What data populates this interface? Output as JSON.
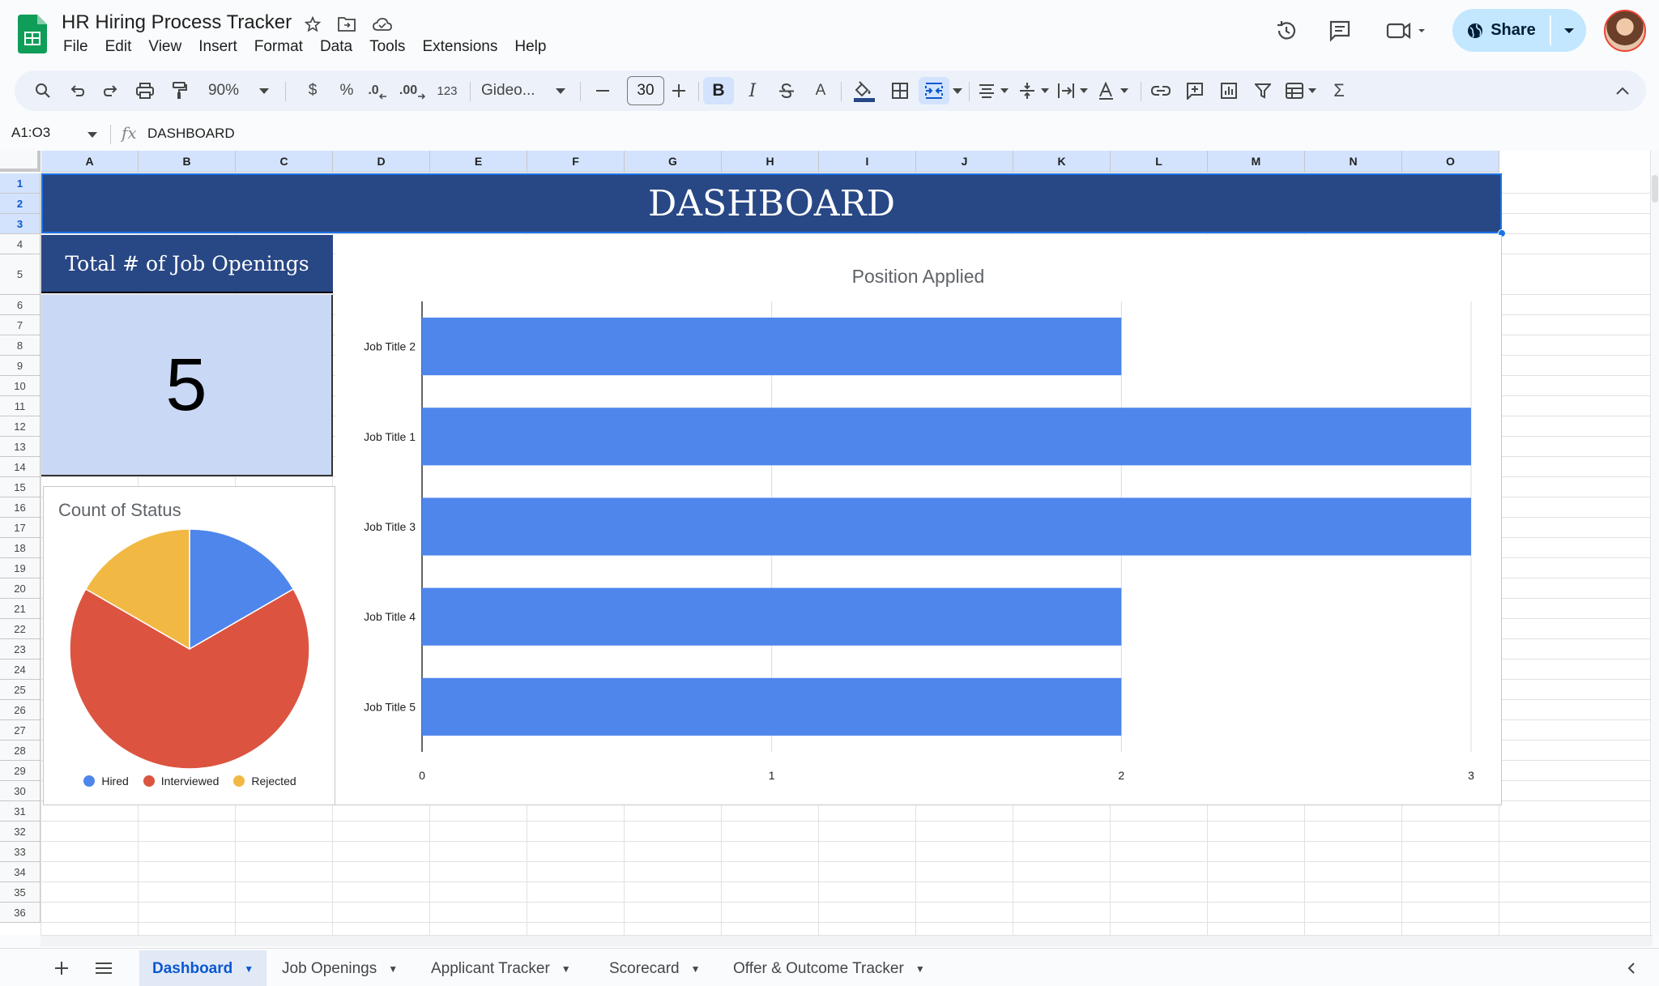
{
  "document": {
    "title": "HR Hiring Process Tracker",
    "menu": [
      "File",
      "Edit",
      "View",
      "Insert",
      "Format",
      "Data",
      "Tools",
      "Extensions",
      "Help"
    ]
  },
  "header": {
    "share_label": "Share"
  },
  "toolbar": {
    "zoom": "90%",
    "currency": "$",
    "percent": "%",
    "decrease_decimal": ".0",
    "increase_decimal": ".00",
    "number_format": "123",
    "font": "Gideo...",
    "font_size": "30",
    "bold": "B",
    "italic": "I",
    "text_color": "A",
    "sum": "Σ"
  },
  "formula_bar": {
    "name_box": "A1:O3",
    "fx": "fx",
    "value": "DASHBOARD"
  },
  "grid": {
    "columns": [
      "A",
      "B",
      "C",
      "D",
      "E",
      "F",
      "G",
      "H",
      "I",
      "J",
      "K",
      "L",
      "M",
      "N",
      "O"
    ],
    "rows": [
      "1",
      "2",
      "3",
      "4",
      "5",
      "6",
      "7",
      "8",
      "9",
      "10",
      "11",
      "12",
      "13",
      "14",
      "15",
      "16",
      "17",
      "18",
      "19",
      "20",
      "21",
      "22",
      "23",
      "24",
      "25",
      "26",
      "27",
      "28",
      "29",
      "30",
      "31",
      "32",
      "33",
      "34",
      "35",
      "36"
    ]
  },
  "dashboard": {
    "banner": "DASHBOARD",
    "job_openings_title": "Total # of Job Openings",
    "job_openings_value": "5"
  },
  "charts": {
    "colors": {
      "blue": "#4f86ec",
      "red": "#dc5440",
      "yellow": "#f1b943",
      "banner": "#284785"
    }
  },
  "chart_data": [
    {
      "type": "pie",
      "title": "Count of Status",
      "categories": [
        "Hired",
        "Interviewed",
        "Rejected"
      ],
      "values": [
        1,
        4,
        1
      ],
      "legend": "bottom"
    },
    {
      "type": "bar",
      "orientation": "horizontal",
      "title": "Position Applied",
      "categories": [
        "Job Title 2",
        "Job Title 1",
        "Job Title 3",
        "Job Title 4",
        "Job Title 5"
      ],
      "values": [
        2,
        3,
        3,
        2,
        2
      ],
      "xlim": [
        0,
        3
      ],
      "xticks": [
        "0",
        "1",
        "2",
        "3"
      ],
      "grid": true
    }
  ],
  "sheets": {
    "tabs": [
      "Dashboard",
      "Job Openings",
      "Applicant Tracker",
      "Scorecard",
      "Offer & Outcome Tracker"
    ],
    "active": "Dashboard"
  }
}
